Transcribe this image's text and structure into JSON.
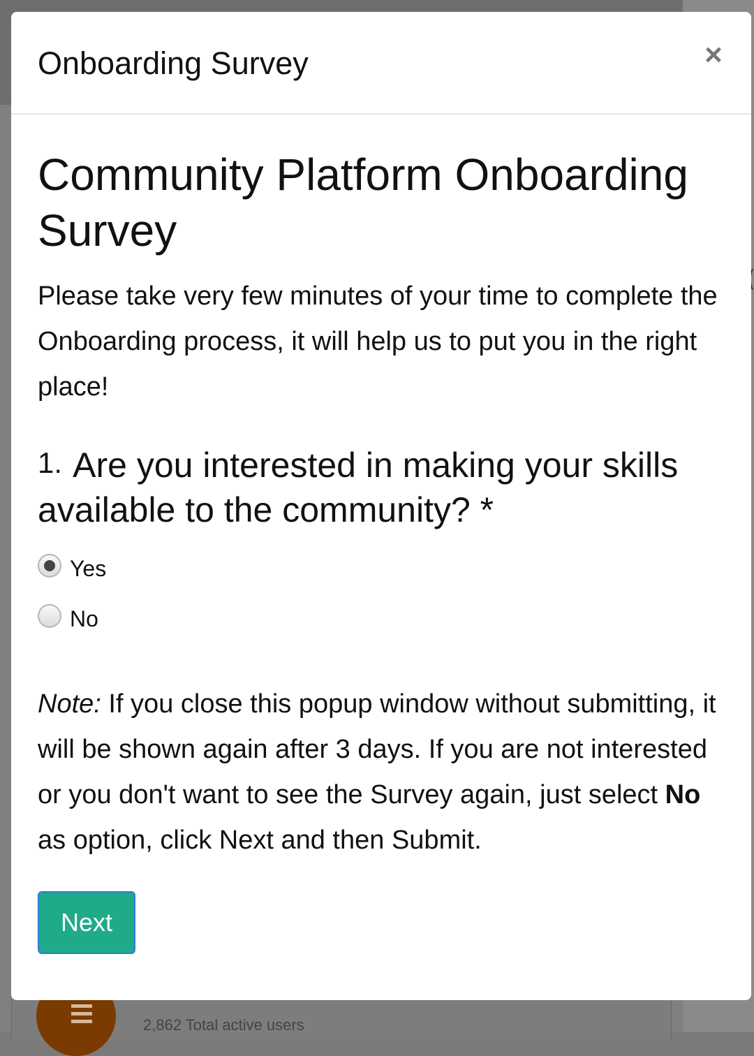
{
  "modal": {
    "header_title": "Onboarding Survey",
    "close_symbol": "×"
  },
  "survey": {
    "title": "Community Platform Onboarding Survey",
    "intro": "Please take very few minutes of your time to complete the Onboarding process, it will help us to put you in the right place!",
    "question": {
      "number": "1.",
      "text": "Are you interested in making your skills available to the community? *",
      "options": [
        {
          "label": "Yes",
          "selected": true
        },
        {
          "label": "No",
          "selected": false
        }
      ]
    },
    "note": {
      "label": "Note:",
      "text_before": " If you close this popup window without submitting, it will be shown again after 3 days. If you are not interested or you don't want to see the Survey again, just select ",
      "bold_word": "No",
      "text_after": " as option, click Next and then Submit."
    },
    "next_label": "Next"
  },
  "background": {
    "stat_text": "2,862 Total active users"
  },
  "colors": {
    "next_button": "#1faa8a",
    "next_button_border": "#2a7fd4",
    "badge": "#7a3a00"
  }
}
